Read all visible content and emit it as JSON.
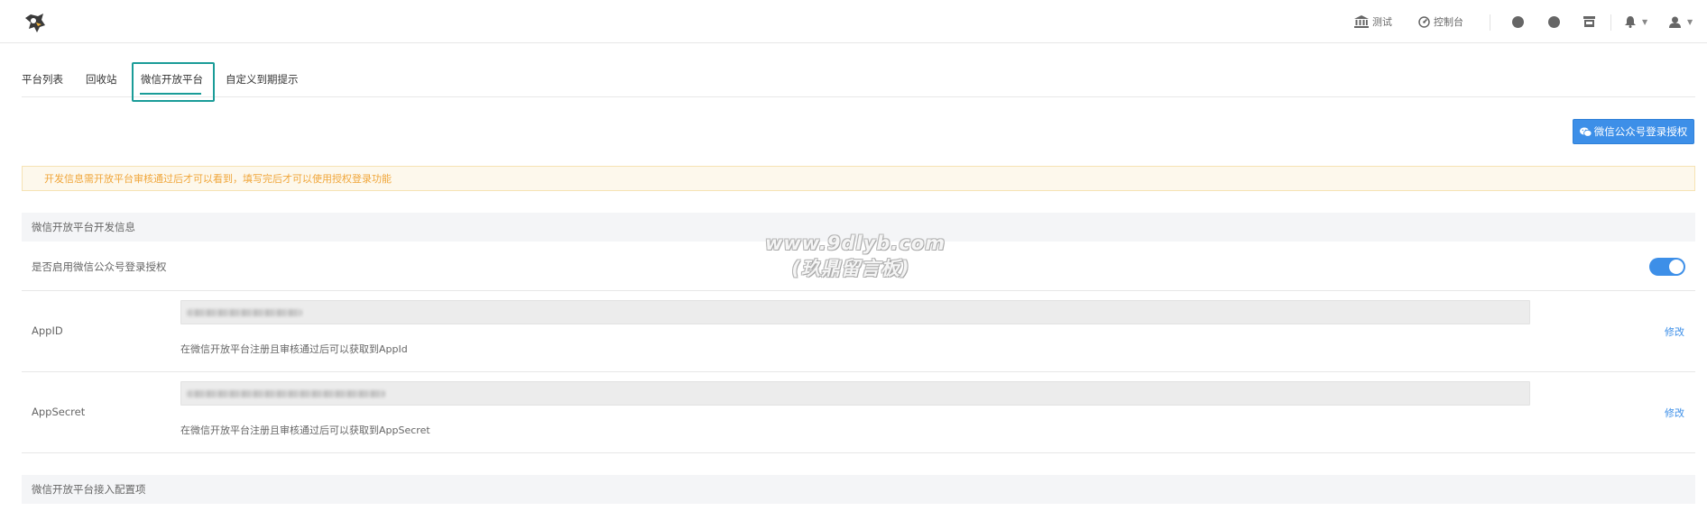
{
  "topbar": {
    "test_label": "测试",
    "console_label": "控制台"
  },
  "tabs": [
    {
      "label": "平台列表"
    },
    {
      "label": "回收站"
    },
    {
      "label": "微信开放平台"
    },
    {
      "label": "自定义到期提示"
    }
  ],
  "active_tab": "微信开放平台",
  "actions": {
    "wechat_login_auth_button": "微信公众号登录授权"
  },
  "alert": {
    "text": "开发信息需开放平台审核通过后才可以看到，填写完后才可以使用授权登录功能"
  },
  "section_dev": {
    "title": "微信开放平台开发信息",
    "enable_label": "是否启用微信公众号登录授权",
    "enable_on": true,
    "appid_label": "AppID",
    "appid_help": "在微信开放平台注册且审核通过后可以获取到AppId",
    "appsecret_label": "AppSecret",
    "appsecret_help": "在微信开放平台注册且审核通过后可以获取到AppSecret",
    "edit_label": "修改"
  },
  "section_config": {
    "title": "微信开放平台接入配置项"
  },
  "watermark": {
    "line1": "www.9dlyb.com",
    "line2": "(玖鼎留言板)"
  },
  "colors": {
    "accent": "#3d8fe8",
    "tab_highlight": "#1a9c98",
    "alert_text": "#f0a63a",
    "alert_bg": "#fdf8ec"
  }
}
